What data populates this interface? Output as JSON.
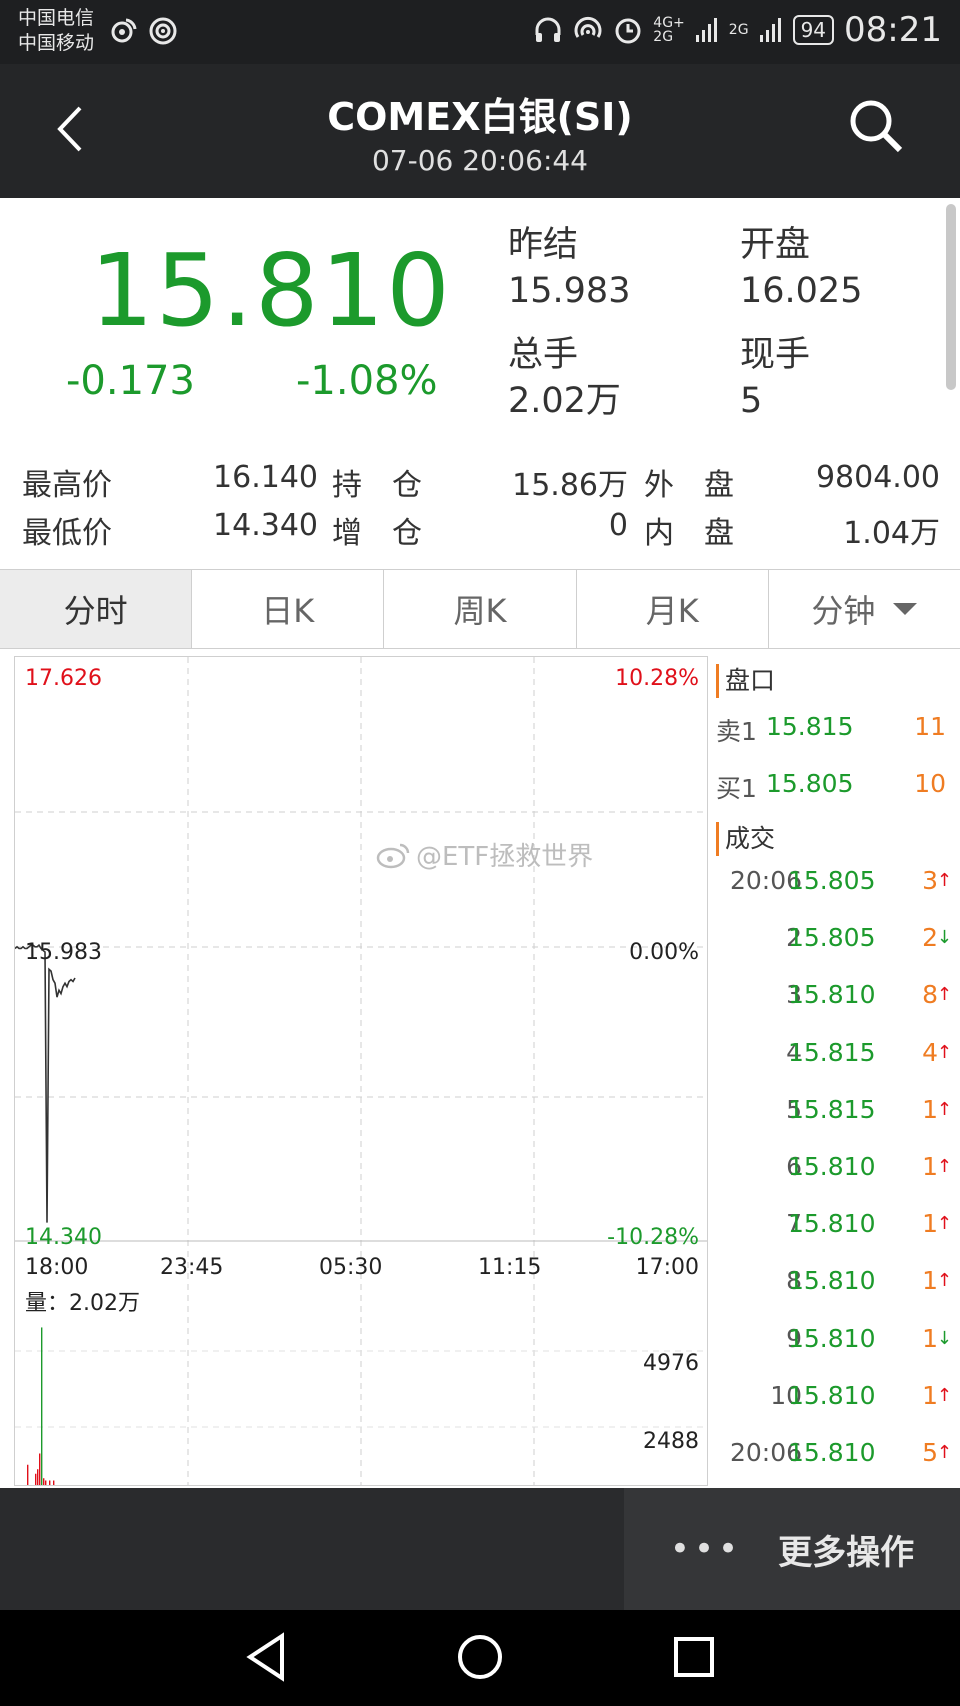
{
  "status_bar": {
    "carrier1": "中国电信",
    "carrier2": "中国移动",
    "net1": "4G+",
    "net2": "2G",
    "net3": "2G",
    "battery": "94",
    "time": "08:21"
  },
  "header": {
    "title": "COMEX白银(SI)",
    "datetime": "07-06 20:06:44"
  },
  "quote": {
    "price": "15.810",
    "change": "-0.173",
    "change_pct": "-1.08%",
    "prev_settle_label": "昨结",
    "prev_settle": "15.983",
    "open_label": "开盘",
    "open": "16.025",
    "total_vol_label": "总手",
    "total_vol": "2.02万",
    "cur_vol_label": "现手",
    "cur_vol": "5"
  },
  "stats": {
    "high_label": "最高价",
    "high": "16.140",
    "low_label": "最低价",
    "low": "14.340",
    "oi_label": "持　仓",
    "oi": "15.86万",
    "oi_inc_label": "增　仓",
    "oi_inc": "0",
    "outer_label": "外　盘",
    "outer": "9804.00",
    "inner_label": "内　盘",
    "inner": "1.04万"
  },
  "tabs": [
    "分时",
    "日K",
    "周K",
    "月K",
    "分钟"
  ],
  "chart_data": {
    "type": "line",
    "y_max_label": "17.626",
    "y_max_pct": "10.28%",
    "y_mid_label": "15.983",
    "y_mid_pct": "0.00%",
    "y_min_label": "14.340",
    "y_min_pct": "-10.28%",
    "ylim": [
      14.34,
      17.626
    ],
    "x_ticks": [
      "18:00",
      "23:45",
      "05:30",
      "11:15",
      "17:00"
    ],
    "series": [
      {
        "values": [
          15.98,
          15.99,
          15.98,
          15.98,
          15.99,
          15.98,
          15.98,
          15.99,
          16.0,
          16.0,
          15.99,
          15.99,
          16.0,
          15.98,
          15.97,
          15.96,
          14.4,
          15.86,
          15.85,
          15.8,
          15.78,
          15.7,
          15.74,
          15.72,
          15.76,
          15.78,
          15.76,
          15.79,
          15.8,
          15.79,
          15.81
        ]
      }
    ],
    "volume_label": "量：",
    "volume_total": "2.02万",
    "vol_tick_high": "4976",
    "vol_tick_mid": "2488",
    "vol_ylim": [
      0,
      7464
    ],
    "volume_bars": [
      {
        "idx": 6,
        "v": 900,
        "c": "red"
      },
      {
        "idx": 10,
        "v": 500,
        "c": "red"
      },
      {
        "idx": 11,
        "v": 700,
        "c": "red"
      },
      {
        "idx": 12,
        "v": 1400,
        "c": "red"
      },
      {
        "idx": 13,
        "v": 7000,
        "c": "green"
      },
      {
        "idx": 14,
        "v": 300,
        "c": "red"
      },
      {
        "idx": 15,
        "v": 200,
        "c": "red"
      },
      {
        "idx": 17,
        "v": 200,
        "c": "red"
      },
      {
        "idx": 19,
        "v": 200,
        "c": "red"
      }
    ]
  },
  "book": {
    "panel_label": "盘口",
    "ask_label": "卖1",
    "ask_price": "15.815",
    "ask_vol": "11",
    "bid_label": "买1",
    "bid_price": "15.805",
    "bid_vol": "10",
    "trades_label": "成交",
    "trades": [
      {
        "t": "20:06",
        "p": "15.805",
        "v": "3",
        "dir": "up"
      },
      {
        "t": "2",
        "p": "15.805",
        "v": "2",
        "dir": "down"
      },
      {
        "t": "3",
        "p": "15.810",
        "v": "8",
        "dir": "up"
      },
      {
        "t": "4",
        "p": "15.815",
        "v": "4",
        "dir": "up"
      },
      {
        "t": "5",
        "p": "15.815",
        "v": "1",
        "dir": "up"
      },
      {
        "t": "6",
        "p": "15.810",
        "v": "1",
        "dir": "up"
      },
      {
        "t": "7",
        "p": "15.810",
        "v": "1",
        "dir": "up"
      },
      {
        "t": "8",
        "p": "15.810",
        "v": "1",
        "dir": "up"
      },
      {
        "t": "9",
        "p": "15.810",
        "v": "1",
        "dir": "down"
      },
      {
        "t": "10",
        "p": "15.810",
        "v": "1",
        "dir": "up"
      },
      {
        "t": "20:06",
        "p": "15.810",
        "v": "5",
        "dir": "up"
      }
    ]
  },
  "watermark": "@ETF拯救世界",
  "actions": {
    "more_label": "更多操作"
  },
  "colors": {
    "up": "#e0101a",
    "down": "#1c9a2c",
    "accent": "#ef7c22"
  }
}
